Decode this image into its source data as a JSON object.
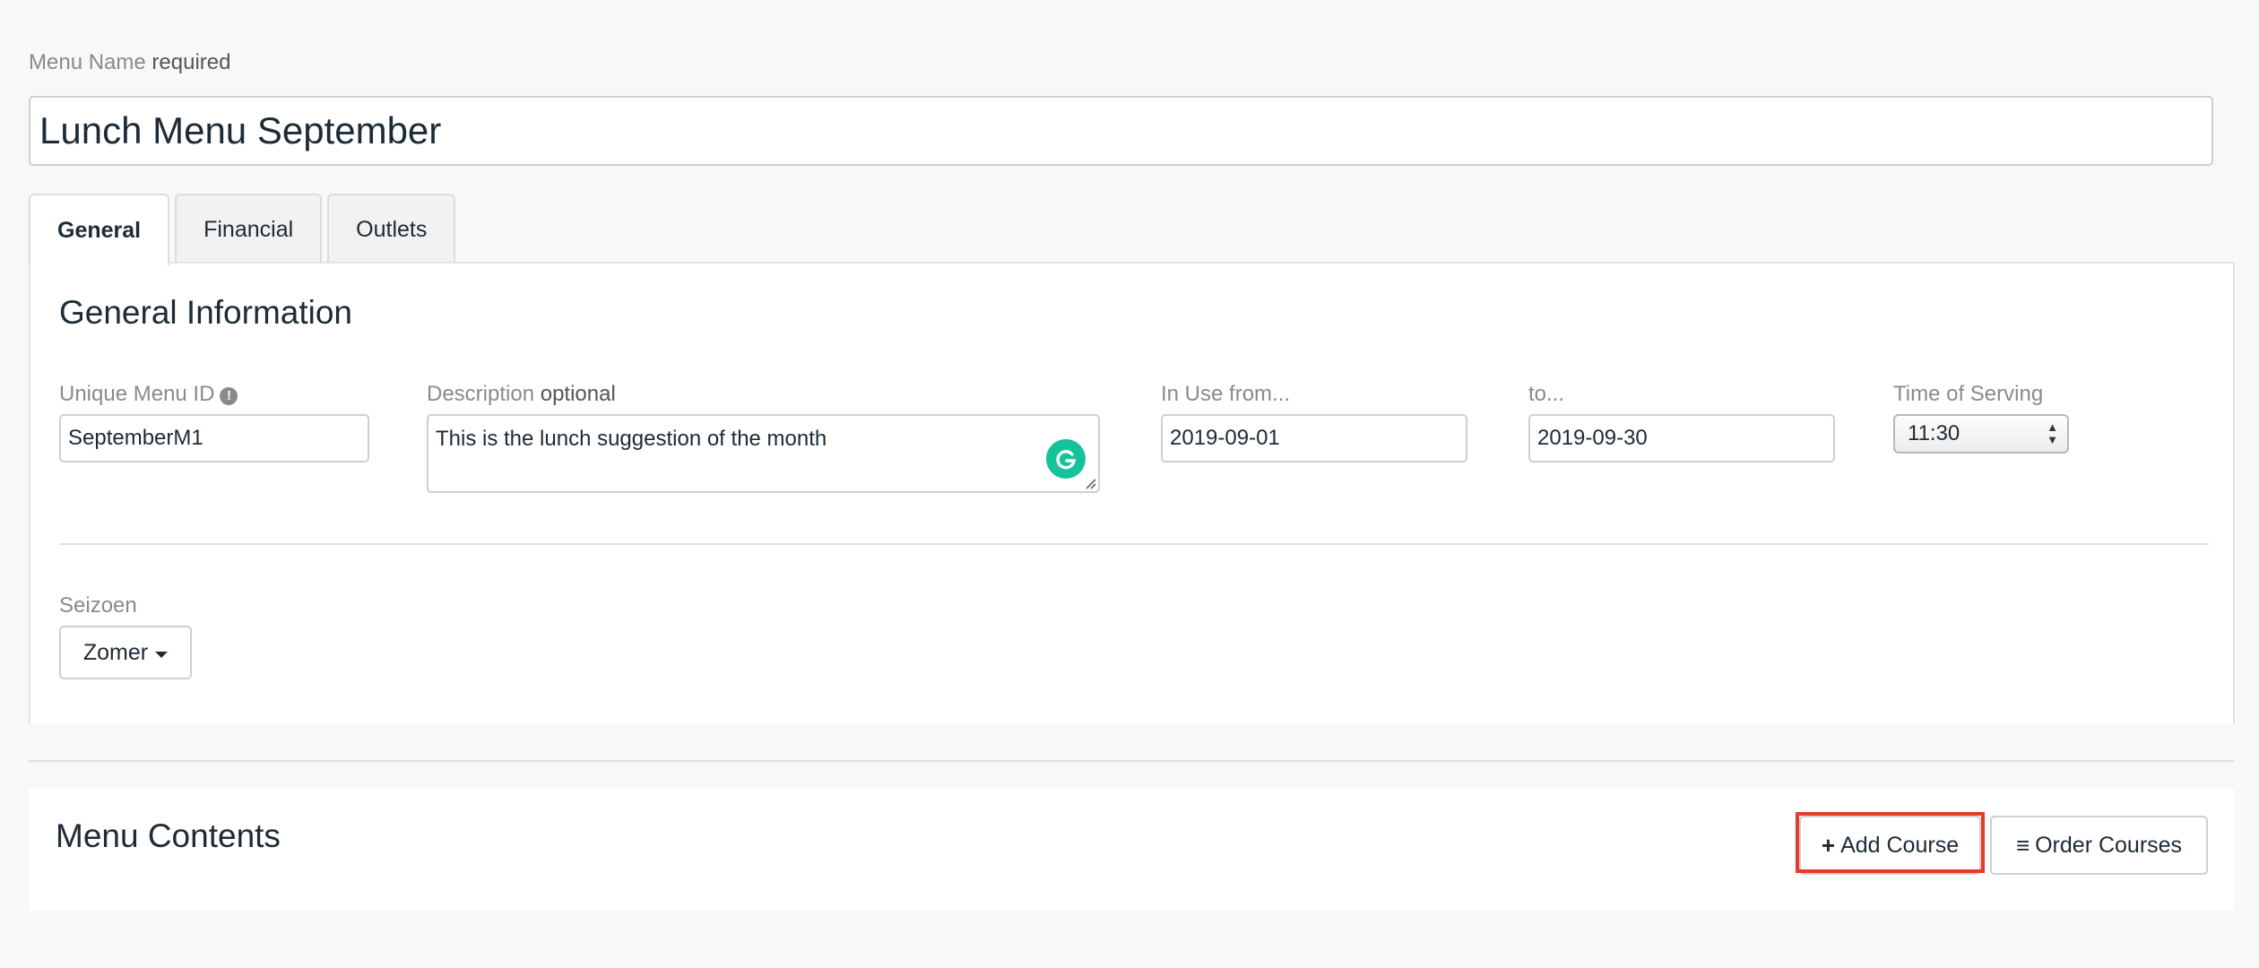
{
  "menu_name": {
    "label": "Menu Name",
    "required_label": "required",
    "value": "Lunch Menu September"
  },
  "tabs": [
    {
      "label": "General",
      "active": true
    },
    {
      "label": "Financial",
      "active": false
    },
    {
      "label": "Outlets",
      "active": false
    }
  ],
  "general": {
    "section_title": "General Information",
    "unique_id": {
      "label": "Unique Menu ID",
      "value": "SeptemberM1",
      "icon": "info-icon"
    },
    "description": {
      "label": "Description",
      "optional_label": "optional",
      "value": "This is the lunch suggestion of the month"
    },
    "in_use_from": {
      "label": "In Use from...",
      "value": "2019-09-01"
    },
    "to": {
      "label": "to...",
      "value": "2019-09-30"
    },
    "time_of_serving": {
      "label": "Time of Serving",
      "value": "11:30"
    },
    "season": {
      "label": "Seizoen",
      "value": "Zomer"
    }
  },
  "menu_contents": {
    "title": "Menu Contents",
    "add_course_label": "Add Course",
    "order_courses_label": "Order Courses"
  },
  "colors": {
    "highlight": "#e53a2c",
    "grammarly": "#15c39a",
    "text": "#1c2b36",
    "muted": "#8a8a8a"
  }
}
